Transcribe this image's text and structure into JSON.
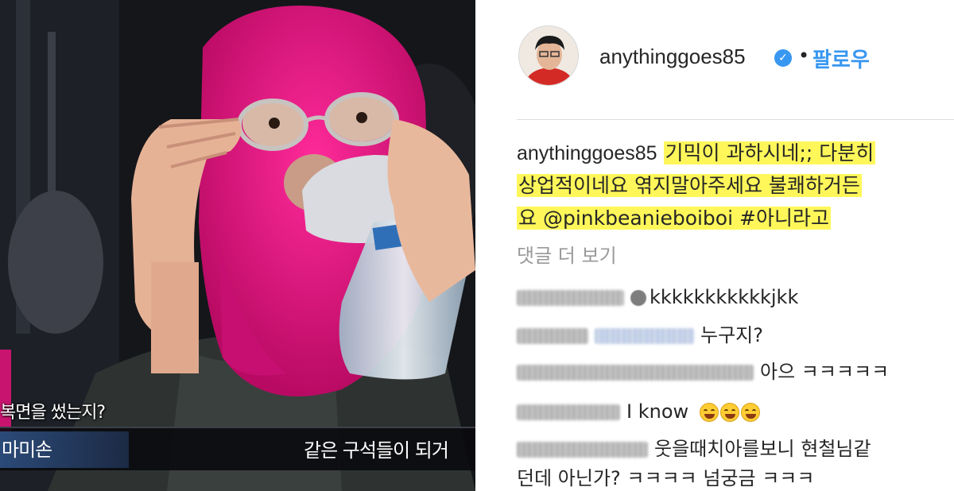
{
  "video": {
    "subtitle_top": "복면을 썼는지?",
    "speaker_name": "마미손",
    "subtitle_bottom": "같은 구석들이 되거"
  },
  "post": {
    "username": "anythinggoes85",
    "follow_label": "팔로우",
    "caption_user": "anythinggoes85",
    "caption_lines": [
      "기믹이 과하시네;; 다분히",
      "상업적이네요 엮지말아주세요 불쾌하거든",
      "요 @pinkbeanieboiboi #아니라고"
    ],
    "more_comments_label": "댓글 더 보기",
    "comments": [
      {
        "text": "kkkkkkkkkkkjkk"
      },
      {
        "text": "누구지?"
      },
      {
        "text": "아으 ㅋㅋㅋㅋㅋ"
      },
      {
        "text": "I know"
      },
      {
        "text": "웃을때치아를보니 현철님같"
      },
      {
        "text": "던데 아닌가? ㅋㅋㅋㅋ 넘궁금 ㅋㅋㅋ"
      }
    ]
  },
  "icons": [
    "avatar",
    "verified-badge-icon",
    "mention-icon",
    "grinning-emoji-icon"
  ],
  "colors": {
    "verified": "#3897f0",
    "follow": "#3897f0",
    "highlight": "#fff75a",
    "mask": "#e0147f"
  }
}
